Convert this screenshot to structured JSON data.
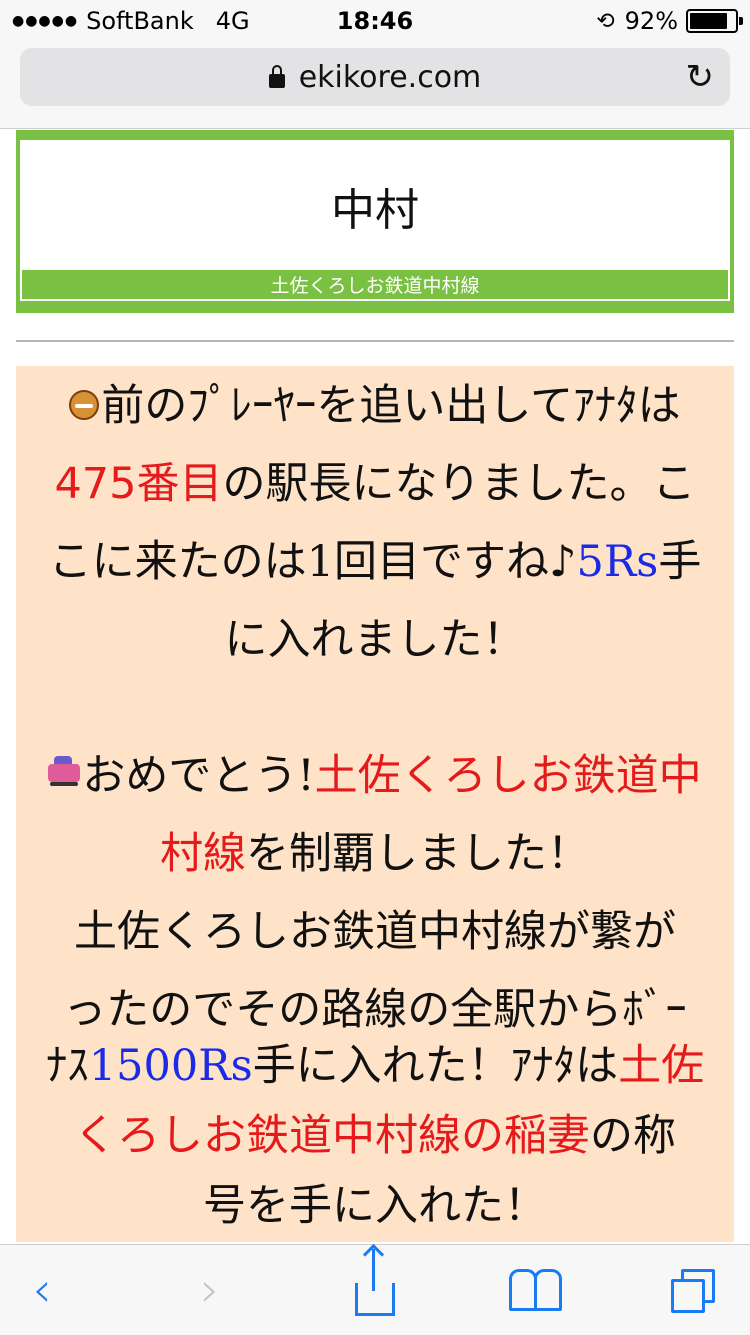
{
  "status_bar": {
    "signal_dots": "●●●●●",
    "carrier": "SoftBank",
    "network": "4G",
    "time": "18:46",
    "battery_percent_label": "92%",
    "battery_level": 0.92
  },
  "browser": {
    "url": "ekikore.com"
  },
  "station": {
    "name": "中村",
    "line": "土佐くろしお鉄道中村線",
    "accent_color": "#7ac143"
  },
  "message": {
    "p1_l1": "前のﾌﾟﾚｰﾔｰを追い出してｱﾅﾀは",
    "p1_l2_rank": "475番目",
    "p1_l2_rest": "の駅長になりました。こ",
    "p1_l3_a": "こに来たのは",
    "p1_l3_count": "1",
    "p1_l3_b": "回目ですね♪",
    "p1_l3_points": "5Rs",
    "p1_l3_c": "手",
    "p1_l4": "に入れました！",
    "p2_l1_a": "おめでとう",
    "p2_l1_excl": "!",
    "p2_l1_line": "土佐くろしお鉄道中",
    "p2_l2_line": "村線",
    "p2_l2_rest": "を制覇しました！",
    "p2_l3": "土佐くろしお鉄道中村線が繋が",
    "p2_l4": "ったのでその路線の全駅からﾎﾞｰ",
    "p2_l5_a": "ﾅｽ",
    "p2_l5_points": "1500Rs",
    "p2_l5_b": "手に入れた！ｱﾅﾀは",
    "p2_l5_title": "土佐",
    "p2_l6_title": "くろしお鉄道中村線の稲妻",
    "p2_l6_rest": "の称",
    "p2_l7": "号を手に入れた！"
  },
  "colors": {
    "message_bg": "#fee3c8",
    "highlight_red": "#e51a1a",
    "points_blue": "#1a2ae5",
    "ios_blue": "#1a7bf2"
  },
  "icons": {
    "face": "face-emoji-icon",
    "car": "car-emoji-icon",
    "lock": "padlock-icon",
    "reload": "reload-icon"
  }
}
